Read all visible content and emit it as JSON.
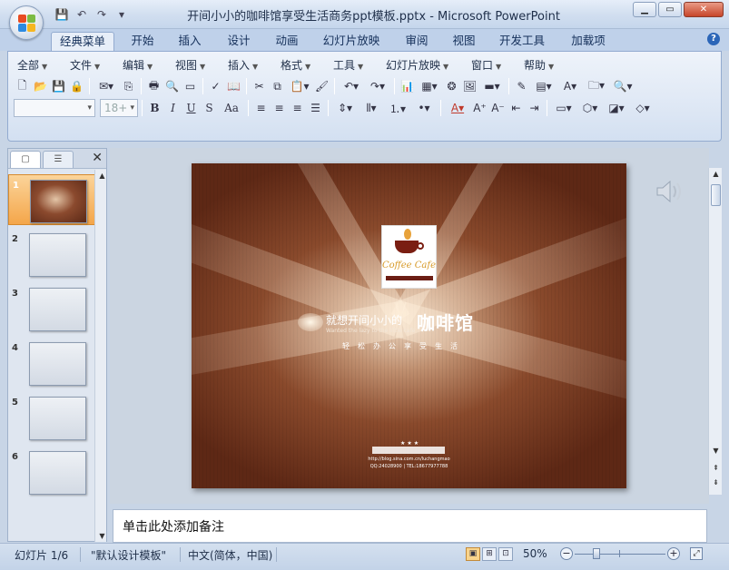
{
  "window": {
    "title": "开间小小的咖啡馆享受生活商务ppt模板.pptx - Microsoft PowerPoint",
    "minimize": "▁",
    "restore": "▭",
    "close": "✕"
  },
  "qat": {
    "save": "💾",
    "undo": "↶",
    "redo": "↷",
    "more": "▾"
  },
  "tabs": [
    "经典菜单",
    "开始",
    "插入",
    "设计",
    "动画",
    "幻灯片放映",
    "审阅",
    "视图",
    "开发工具",
    "加载项"
  ],
  "help": "?",
  "menus": [
    "全部",
    "文件",
    "编辑",
    "视图",
    "插入",
    "格式",
    "工具",
    "幻灯片放映",
    "窗口",
    "帮助"
  ],
  "font": {
    "name": "",
    "size": "18+"
  },
  "format_buttons": [
    "B",
    "I",
    "U",
    "S",
    "Aa"
  ],
  "left_pane": {
    "slides": [
      "1",
      "2",
      "3",
      "4",
      "5",
      "6"
    ]
  },
  "slide": {
    "logo_text": "Coffee Cafe",
    "title_cn": "就想开间小小的",
    "title_big": "咖啡馆",
    "subtitle_en": "Wanted the lazy to the little cafe",
    "subtitle_cn": "轻松办公享受生活",
    "footer_url": "http://blog.sina.com.cn/luchangmao",
    "footer_tel": "QQ:24028900  | TEL:18677977788",
    "stars": "★★★"
  },
  "notes": {
    "placeholder": "单击此处添加备注"
  },
  "status": {
    "slide_info": "幻灯片 1/6",
    "theme": "\"默认设计模板\"",
    "language": "中文(简体，中国)",
    "zoom": "50%"
  }
}
